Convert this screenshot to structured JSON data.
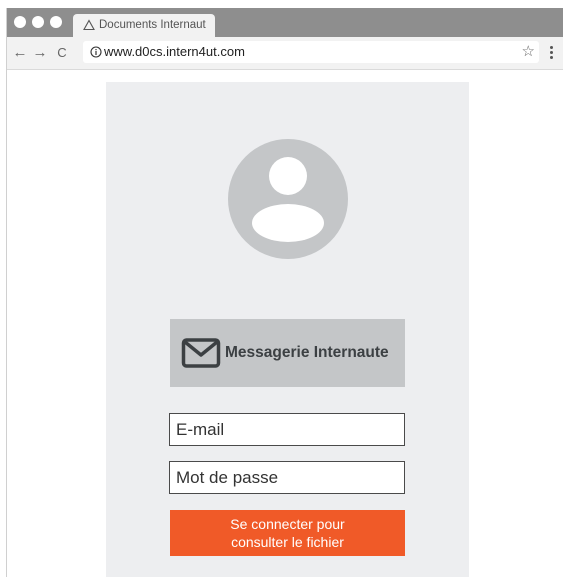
{
  "browser": {
    "tab_title": "Documents Internaut",
    "url": "www.d0cs.intern4ut.com",
    "back_icon": "←",
    "forward_icon": "→",
    "reload_icon": "C",
    "star_icon": "☆"
  },
  "login": {
    "brand_label": "Messagerie Internaute",
    "email_placeholder": "E-mail",
    "password_placeholder": "Mot de passe",
    "submit_line1": "Se connecter pour",
    "submit_line2": "consulter le fichier"
  },
  "colors": {
    "accent": "#f05a28",
    "panel_bg": "#edeef0",
    "brand_box": "#c4c6c8",
    "avatar": "#c4c6c8",
    "tabbar": "#8e8e8e"
  }
}
